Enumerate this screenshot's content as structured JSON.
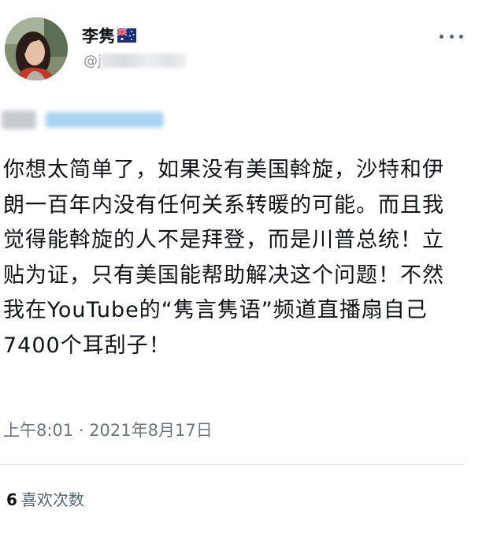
{
  "tweet": {
    "author": {
      "display_name": "李隽",
      "flag": "australia-flag-icon",
      "handle": "@j"
    },
    "body_lines": [
      "你想太简单了，如果没有美国斡旋，沙特和伊",
      "朗一百年内没有任何关系转暖的可能。而且我",
      "觉得能斡旋的人不是拜登，而是川普总统！立",
      "贴为证，只有美国能帮助解决这个问题！不然",
      "我在YouTube的“隽言隽语”频道直播扇自己",
      "7400个耳刮子！"
    ],
    "timestamp": "上午8:01 · 2021年8月17日",
    "likes": {
      "count": "6",
      "label": "喜欢次数"
    }
  },
  "colors": {
    "text": "#0f1419",
    "secondary": "#536471",
    "timestamp": "#687684",
    "divider": "#dfe3e6",
    "blur_link": "#a9d3f1"
  }
}
